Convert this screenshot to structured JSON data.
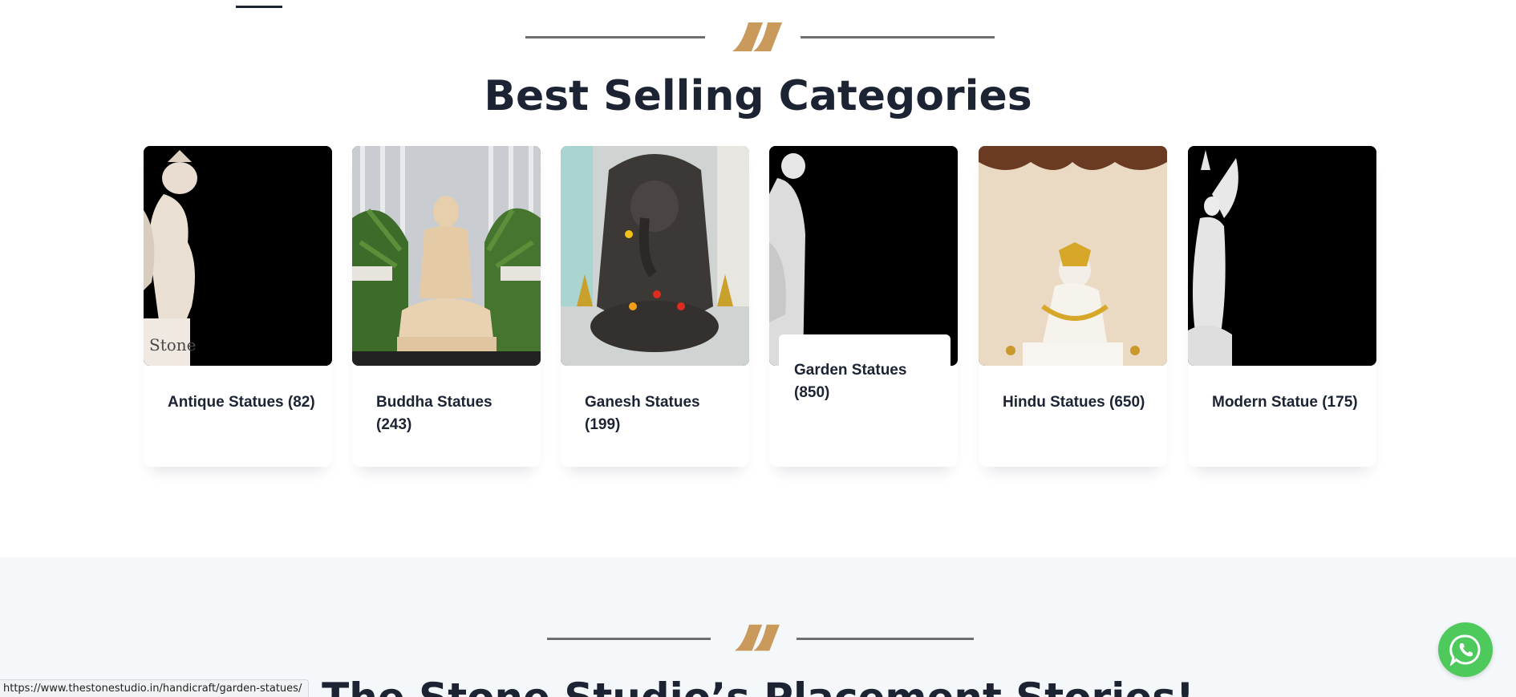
{
  "section_best_selling": {
    "heading": "Best Selling Categories"
  },
  "categories": [
    {
      "label": "Antique Statues (82)",
      "url": ""
    },
    {
      "label": "Buddha Statues (243)"
    },
    {
      "label": "Ganesh Statues (199)"
    },
    {
      "label": "Garden Statues (850)"
    },
    {
      "label": "Hindu Statues (650)"
    },
    {
      "label": "Modern Statue (175)"
    }
  ],
  "section_placement": {
    "heading": "The Stone Studio’s Placement Stories!"
  },
  "status_bar": {
    "url": "https://www.thestonestudio.in/handicraft/garden-statues/"
  },
  "icons": {
    "divider": "quote-mark-icon",
    "chat": "whatsapp-icon"
  },
  "colors": {
    "accent_gold": "#c99a5b",
    "heading_dark": "#1c2333",
    "whatsapp_green": "#4ec95c",
    "section_bg": "#f5f8fb"
  }
}
